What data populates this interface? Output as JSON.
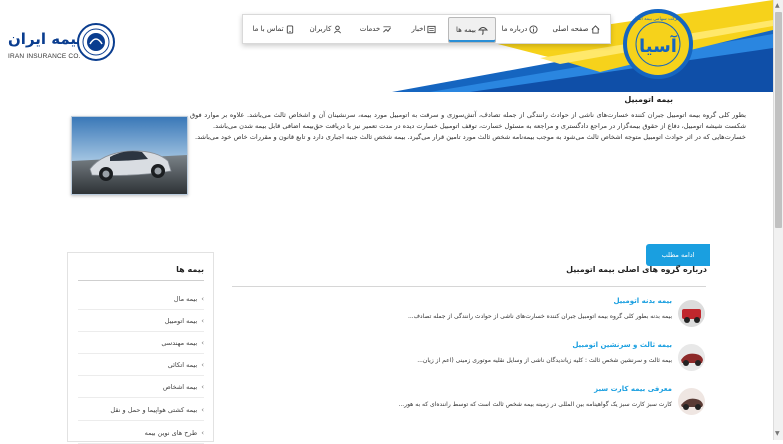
{
  "header": {
    "brand_text": "بیمه ایران",
    "brand_sub": "IRAN INSURANCE CO.",
    "asia_brand": "آسیا",
    "asia_ring_text": "شرکت سهامی بیمه آسیا"
  },
  "nav": {
    "items": [
      {
        "label": "صفحه اصلی"
      },
      {
        "label": "درباره ما"
      },
      {
        "label": "بیمه ها"
      },
      {
        "label": "اخبار"
      },
      {
        "label": "خدمات"
      },
      {
        "label": "کاربران"
      },
      {
        "label": "تماس با ما"
      }
    ]
  },
  "section": {
    "title": "بیمه اتومبیل",
    "intro_p1": "بطور کلی گروه بیمه اتومبیل جبران کننده خسارت‌های ناشی از حوادث رانندگی از جمله تصادف، آتش‌سوزی و سرقت به اتومبیل مورد بیمه، سرنشینان آن و اشخاص ثالث می‌باشد. علاوه بر موارد فوق شکست شیشه اتومبیل، دفاع از حقوق بیمه‌گزار در مراجع دادگستری و مراجعه به مسئول خسارت، توقف اتومبیل خسارت دیده در مدت تعمیر نیز با دریافت حق‌بیمه اضافی قابل بیمه شدن می‌باشد.",
    "intro_p2": "خسارت‌هایی که در اثر حوادث اتومبیل متوجه اشخاص ثالث می‌شود به موجب بیمه‌نامه شخص ثالث مورد تامین قرار می‌گیرد. بیمه شخص ثالث جنبه اجباری دارد و تابع قانون و مقررات خاص خود می‌باشد.",
    "more_label": "ادامه مطلب"
  },
  "sidebar": {
    "title": "بیمه ها",
    "items": [
      {
        "label": "بیمه مال"
      },
      {
        "label": "بیمه اتومبیل"
      },
      {
        "label": "بیمه مهندسی"
      },
      {
        "label": "بیمه اتکائی"
      },
      {
        "label": "بیمه اشخاص"
      },
      {
        "label": "بیمه کشتی هواپیما و حمل و نقل"
      },
      {
        "label": "طرح های نوین بیمه"
      }
    ]
  },
  "content": {
    "title": "درباره گروه های اصلی بیمه اتومبیل",
    "posts": [
      {
        "title": "بیمه بدنه اتومبیل",
        "text": "بیمه بدنه بطور کلی گروه بیمه اتومبیل جبران کننده خسارت‌های ناشی از حوادث رانندگی از جمله تصادف..."
      },
      {
        "title": "بیمه ثالث و سرنشین اتومبیل",
        "text": "بیمه ثالث و سرنشین شخص ثالث : کلیه زیاندیدگان ناشی از وسایل نقلیه موتوری زمینی (اعم از زیان..."
      },
      {
        "title": "معرفی بیمه کارت سبز",
        "text": "کارت سبز کارت سبز یک گواهینامه بین المللی در زمینه بیمه شخص ثالث است که توسط راننده‌ای که به هور..."
      }
    ]
  },
  "colors": {
    "accent": "#1a9fe0",
    "header_blue": "#1565c0",
    "header_yellow": "#f6d21b",
    "logo_blue": "#0a3d8f"
  }
}
